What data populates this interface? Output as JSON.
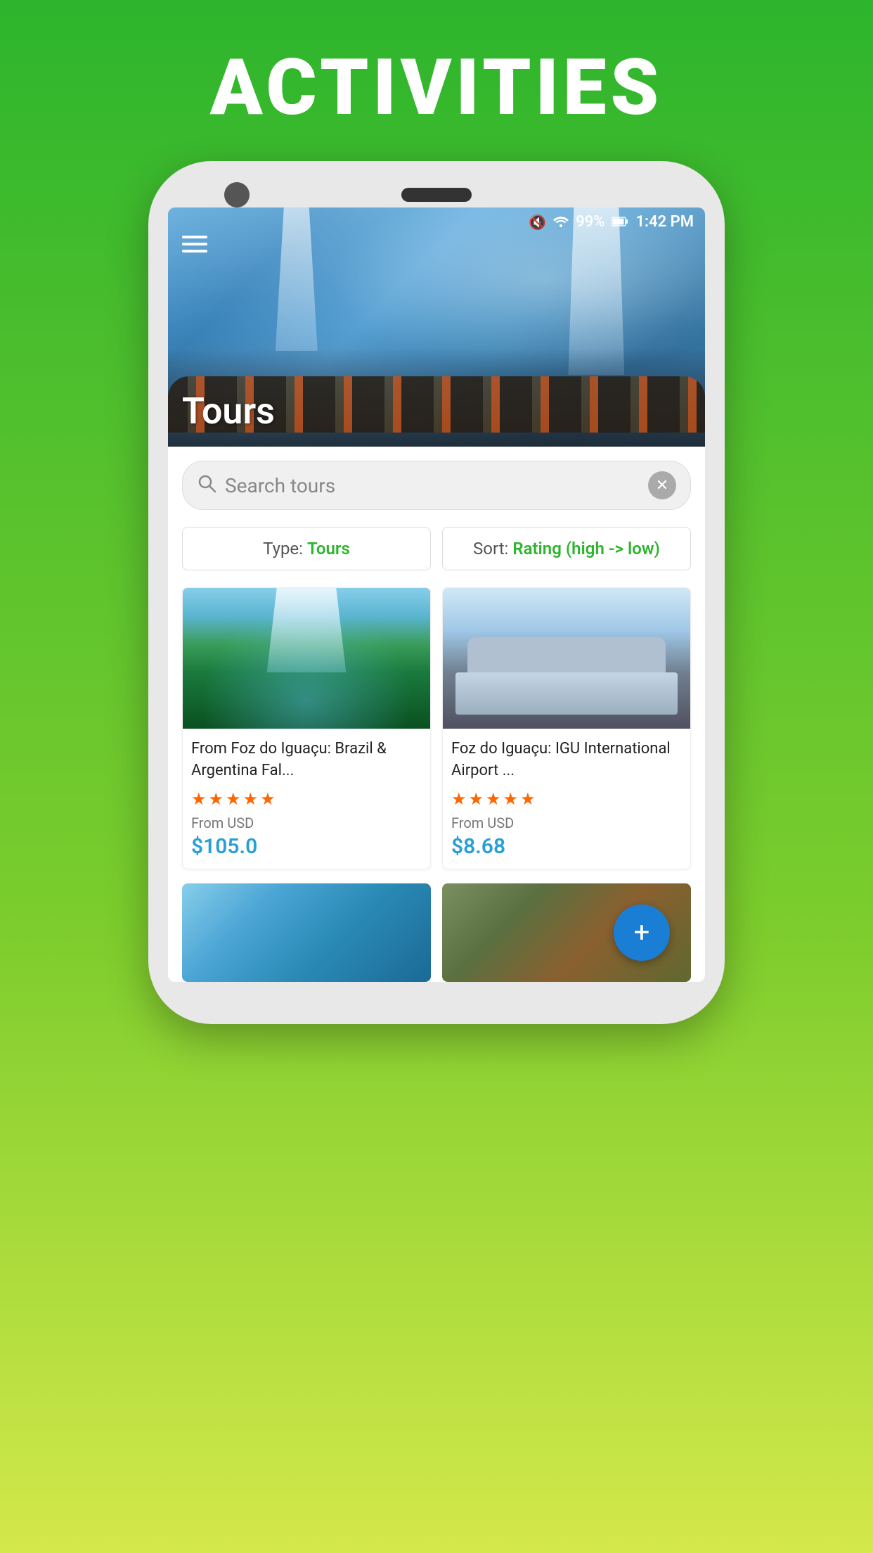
{
  "page": {
    "title": "ACTIVITIES",
    "background_gradient_top": "#2db52d",
    "background_gradient_bottom": "#d4e84a"
  },
  "status_bar": {
    "mute_icon": "🔇",
    "wifi_icon": "WiFi",
    "battery_percent": "99%",
    "battery_icon": "🔋",
    "time": "1:42 PM"
  },
  "hero": {
    "title": "Tours",
    "menu_icon": "☰"
  },
  "search": {
    "placeholder": "Search tours",
    "clear_icon": "✕"
  },
  "filters": {
    "type_label": "Type:",
    "type_value": "Tours",
    "sort_label": "Sort:",
    "sort_value": "Rating (high -> low)"
  },
  "tours": [
    {
      "id": 1,
      "name": "From Foz do Iguaçu: Brazil & Argentina Fal...",
      "rating": 5,
      "from_label": "From USD",
      "price": "$105.0",
      "image_type": "falls"
    },
    {
      "id": 2,
      "name": "Foz do Iguaçu: IGU International Airport ...",
      "rating": 5,
      "from_label": "From USD",
      "price": "$8.68",
      "image_type": "van"
    }
  ],
  "bottom_row": [
    {
      "id": 3,
      "image_type": "landscape"
    },
    {
      "id": 4,
      "image_type": "eagle"
    }
  ],
  "fab": {
    "icon": "+",
    "label": "Add"
  }
}
